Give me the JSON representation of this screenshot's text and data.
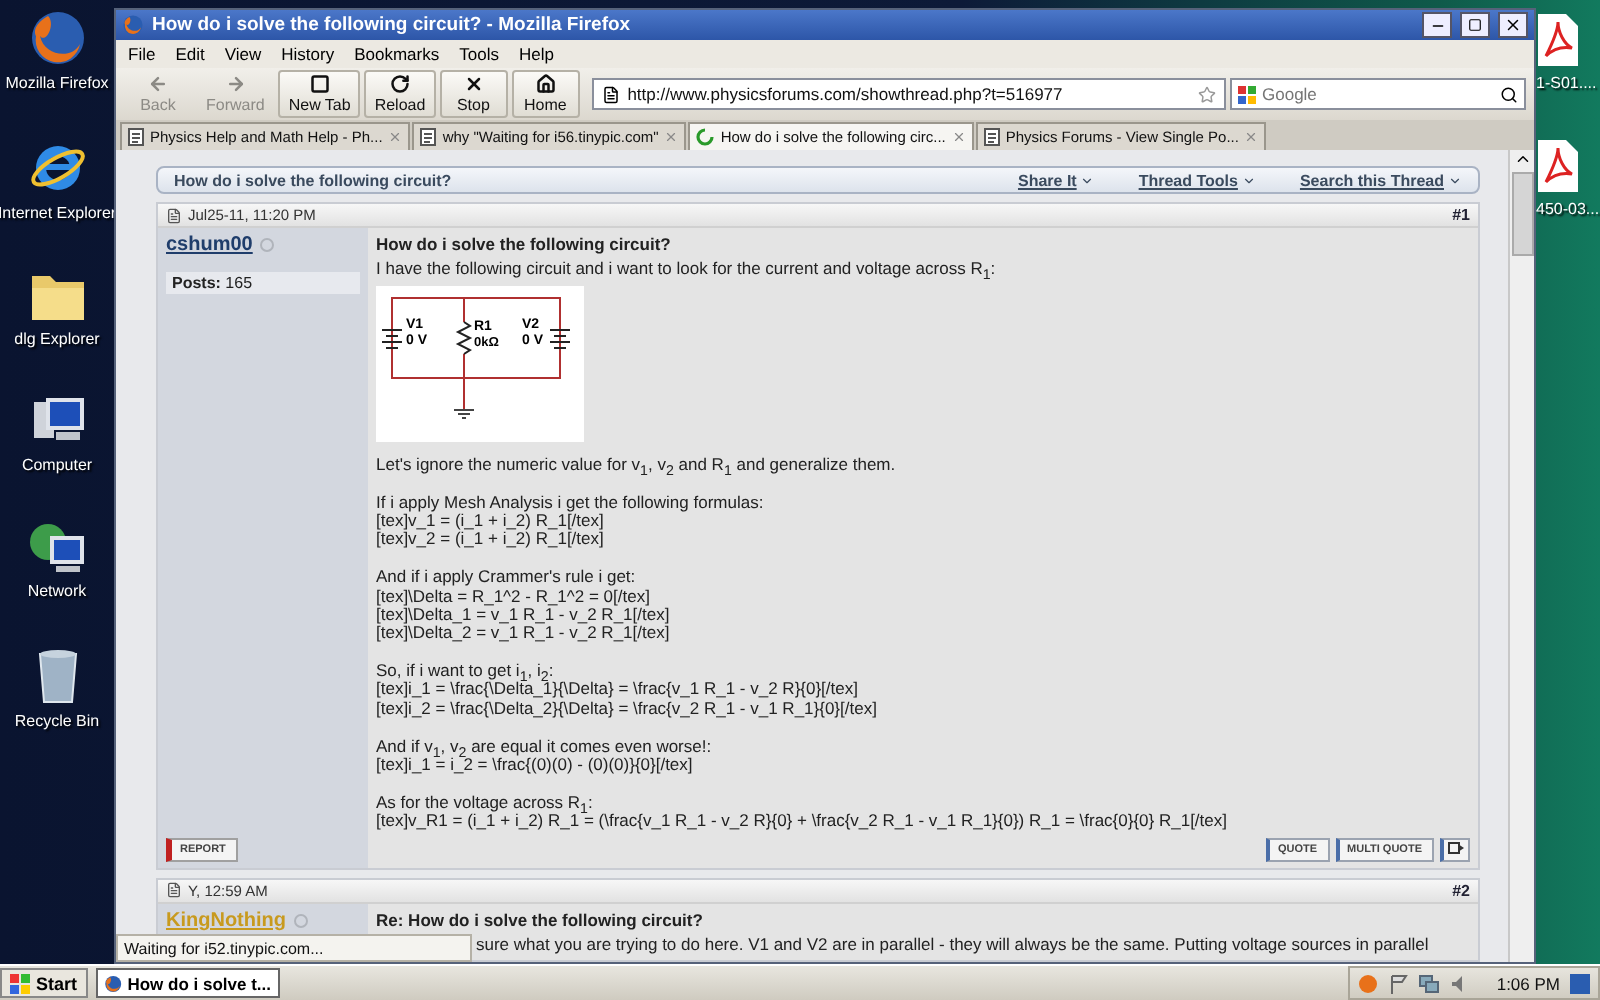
{
  "desktop_left": [
    {
      "kind": "firefox",
      "label": "Mozilla Firefox"
    },
    {
      "kind": "ie",
      "label": "Internet Explorer"
    },
    {
      "kind": "folder",
      "label": "dlg Explorer"
    },
    {
      "kind": "computer",
      "label": "Computer"
    },
    {
      "kind": "network",
      "label": "Network"
    },
    {
      "kind": "recycle",
      "label": "Recycle Bin"
    }
  ],
  "desktop_right": [
    {
      "label": "1-S01...."
    },
    {
      "label": "450-03..."
    }
  ],
  "window": {
    "title": "How do i solve the following circuit? - Mozilla Firefox"
  },
  "menu": [
    "File",
    "Edit",
    "View",
    "History",
    "Bookmarks",
    "Tools",
    "Help"
  ],
  "nav_buttons": [
    {
      "kind": "back",
      "label": "Back",
      "disabled": true
    },
    {
      "kind": "forward",
      "label": "Forward",
      "disabled": true
    },
    {
      "kind": "newtab",
      "label": "New Tab",
      "disabled": false
    },
    {
      "kind": "reload",
      "label": "Reload",
      "disabled": false
    },
    {
      "kind": "stop",
      "label": "Stop",
      "disabled": false
    },
    {
      "kind": "home",
      "label": "Home",
      "disabled": false
    }
  ],
  "address": "http://www.physicsforums.com/showthread.php?t=516977",
  "search": {
    "placeholder": "Google"
  },
  "tabs": [
    {
      "label": "Physics Help and Math Help - Ph...",
      "selected": false,
      "loading": false
    },
    {
      "label": "why \"Waiting for i56.tinypic.com\"",
      "selected": false,
      "loading": false
    },
    {
      "label": "How do i solve the following circ...",
      "selected": true,
      "loading": true
    },
    {
      "label": "Physics Forums - View Single Po...",
      "selected": false,
      "loading": false
    }
  ],
  "thread": {
    "title": "How do i solve the following circuit?",
    "tools": [
      "Share It",
      "Thread Tools",
      "Search this Thread"
    ]
  },
  "posts": [
    {
      "date": "Jul25-11, 11:20 PM",
      "number": "#1",
      "author": "cshum00",
      "color": "#1f3d6b",
      "stats": "**Posts:** 165",
      "title": "How do i solve the following circuit?",
      "intro": "I have the following circuit and i want to look for the current and voltage across R$_{1}$:",
      "circuit": {
        "left_source": "V1",
        "left_value": "0 V",
        "resistor": "R1",
        "resistor_value": "0kΩ",
        "right_source": "V2",
        "right_value": "0 V"
      },
      "paragraphs": [
        [
          "Let's ignore the numeric value for v$_{1}$, v$_{2}$ and R$_{1}$ and generalize them."
        ],
        [
          "If i apply Mesh Analysis i get the following formulas:",
          "[tex]v_1 = (i_1 + i_2) R_1[/tex]",
          "[tex]v_2 = (i_1 + i_2) R_1[/tex]"
        ],
        [
          "And if i apply Crammer's rule i get:",
          "[tex]\\Delta = R_1^2 - R_1^2 = 0[/tex]",
          "[tex]\\Delta_1 = v_1 R_1 - v_2 R_1[/tex]",
          "[tex]\\Delta_2 = v_1 R_1 - v_2 R_1[/tex]"
        ],
        [
          "So, if i want to get i$_{1}$, i$_{2}$:",
          "[tex]i_1 = \\frac{\\Delta_1}{\\Delta} = \\frac{v_1 R_1 - v_2 R}{0}[/tex]",
          "[tex]i_2 = \\frac{\\Delta_2}{\\Delta} = \\frac{v_2 R_1 - v_1 R_1}{0}[/tex]"
        ],
        [
          "And if v$_{1}$, v$_{2}$ are equal it comes even worse!:",
          "[tex]i_1 = i_2 = \\frac{(0)(0) - (0)(0)}{0}[/tex]"
        ],
        [
          "As for the voltage across R$_{1}$:",
          "[tex]v_R1 = (i_1 + i_2) R_1 = (\\frac{v_1 R_1 - v_2 R}{0} + \\frac{v_2 R_1 - v_1 R_1}{0}) R_1 = \\frac{0}{0} R_1[/tex]"
        ]
      ],
      "report": "REPORT",
      "buttons": [
        "QUOTE",
        "MULTI QUOTE"
      ]
    },
    {
      "date": "Y, 12:59 AM",
      "number": "#2",
      "author": "KingNothing",
      "color": "#c89a1e",
      "title": "Re: How do i solve the following circuit?",
      "paragraphs": [
        [
          "sure what you are trying to do here. V1 and V2 are in parallel - they will always be the same. Putting voltage sources in parallel"
        ]
      ]
    }
  ],
  "status": "Waiting for i52.tinypic.com...",
  "taskbar": {
    "start": "Start",
    "task": "How do i solve t...",
    "clock": "1:06 PM"
  }
}
